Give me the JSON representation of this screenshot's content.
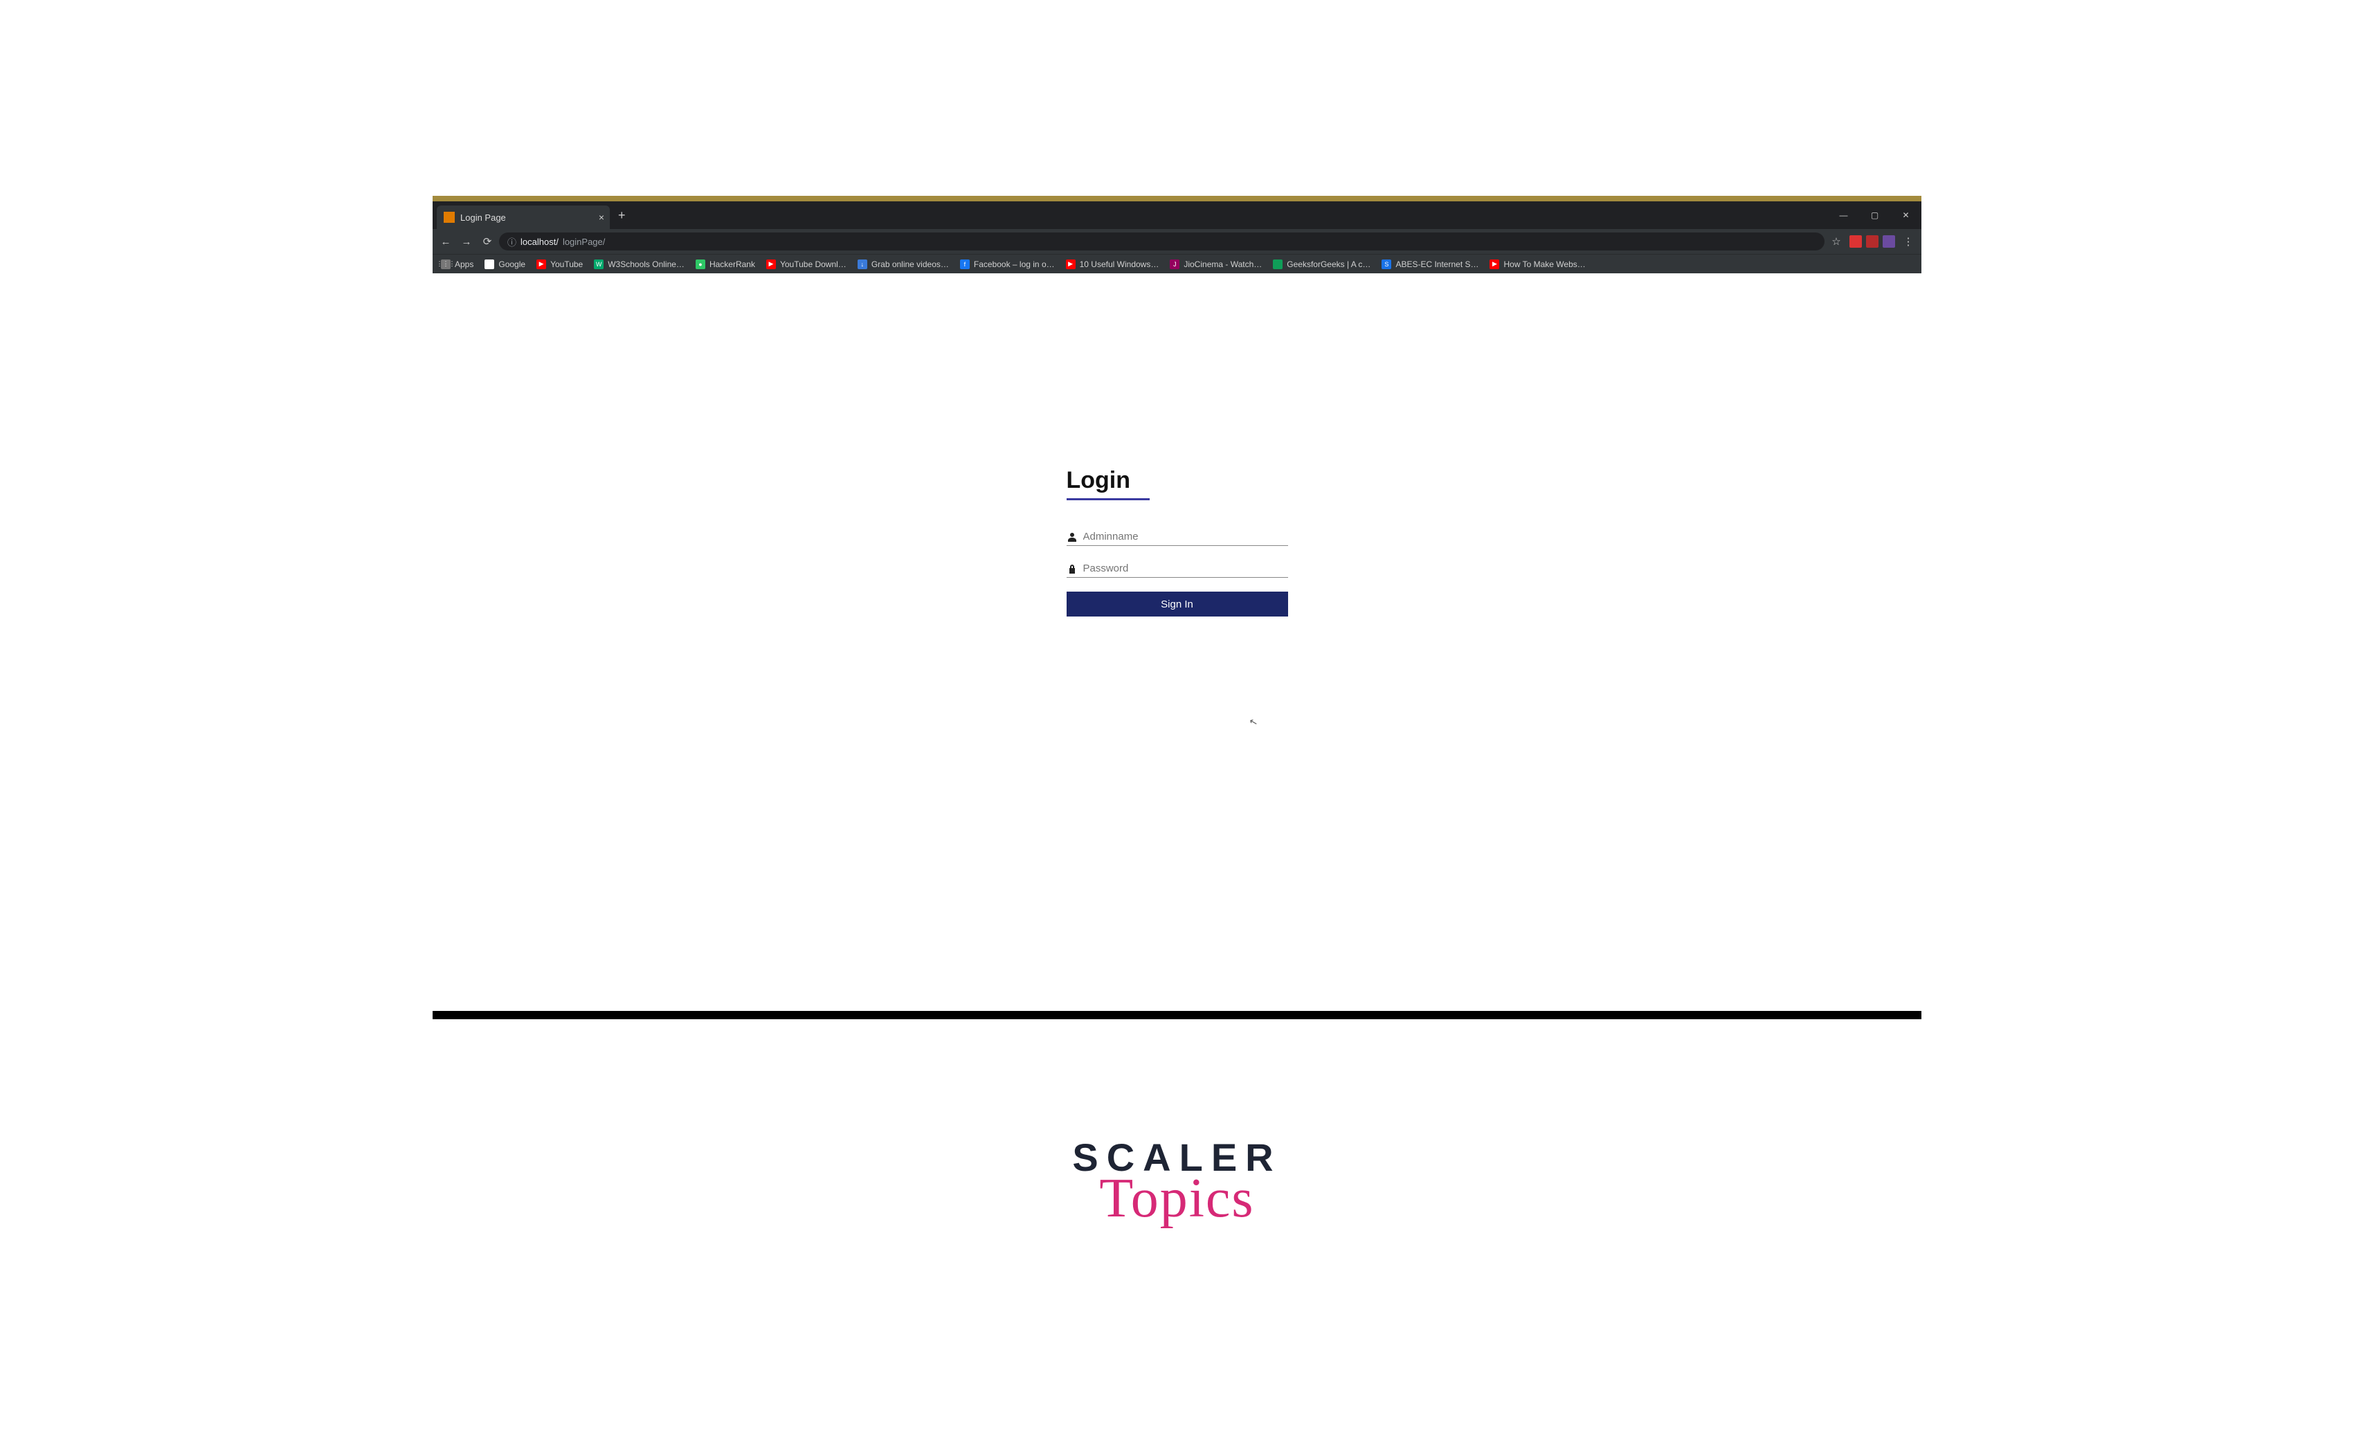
{
  "browser": {
    "tab": {
      "title": "Login Page"
    },
    "url": {
      "prefix": "localhost/",
      "path": "loginPage/"
    },
    "windowControls": {
      "min": "—",
      "max": "▢",
      "close": "✕"
    },
    "nav": {
      "back": "←",
      "forward": "→",
      "reload": "⟳",
      "info": "ⓘ"
    },
    "addrRight": {
      "star": "☆",
      "menu": "⋮"
    }
  },
  "bookmarks": [
    {
      "icon": "⋮⋮⋮",
      "label": "Apps",
      "color": "#777"
    },
    {
      "icon": "G",
      "label": "Google",
      "color": "#fff"
    },
    {
      "icon": "▶",
      "label": "YouTube",
      "color": "#ff0000"
    },
    {
      "icon": "W",
      "label": "W3Schools Online…",
      "color": "#04AA6D"
    },
    {
      "icon": "●",
      "label": "HackerRank",
      "color": "#2ec866"
    },
    {
      "icon": "▶",
      "label": "YouTube Downl…",
      "color": "#ff0000"
    },
    {
      "icon": "↓",
      "label": "Grab online videos…",
      "color": "#3a7ad9"
    },
    {
      "icon": "f",
      "label": "Facebook – log in o…",
      "color": "#1877f2"
    },
    {
      "icon": "▶",
      "label": "10 Useful Windows…",
      "color": "#ff0000"
    },
    {
      "icon": "J",
      "label": "JioCinema - Watch…",
      "color": "#94005e"
    },
    {
      "icon": "",
      "label": "GeeksforGeeks | A c…",
      "color": "#0f9d58"
    },
    {
      "icon": "S",
      "label": "ABES-EC Internet S…",
      "color": "#1a73e8"
    },
    {
      "icon": "▶",
      "label": "How To Make Webs…",
      "color": "#ff0000"
    }
  ],
  "login": {
    "title": "Login",
    "usernamePlaceholder": "Adminname",
    "passwordPlaceholder": "Password",
    "submitLabel": "Sign In"
  },
  "brand": {
    "line1": "SCALER",
    "line2": "Topics"
  }
}
